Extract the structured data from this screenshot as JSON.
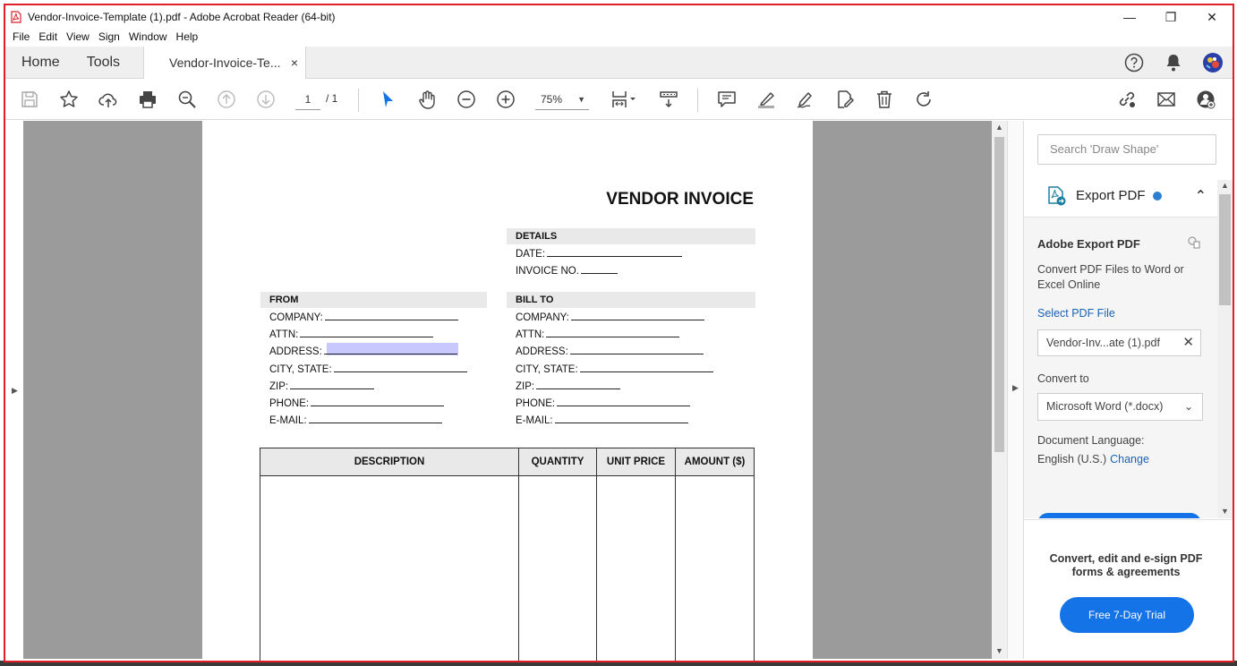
{
  "window": {
    "title": "Vendor-Invoice-Template (1).pdf - Adobe Acrobat Reader (64-bit)",
    "controls": {
      "minimize": "—",
      "restore": "❐",
      "close": "✕"
    }
  },
  "menu": [
    "File",
    "Edit",
    "View",
    "Sign",
    "Window",
    "Help"
  ],
  "tabs": {
    "home": "Home",
    "tools": "Tools",
    "document": "Vendor-Invoice-Te...",
    "close": "×"
  },
  "toolbar": {
    "page_current": "1",
    "page_total": "/ 1",
    "zoom": "75%",
    "zoom_caret": "▼"
  },
  "document": {
    "title": "VENDOR INVOICE",
    "details": {
      "heading": "DETAILS",
      "date": "DATE:",
      "invoice_no": "INVOICE NO."
    },
    "from": {
      "heading": "FROM",
      "company": "COMPANY:",
      "attn": "ATTN:",
      "address": "ADDRESS:",
      "city_state": "CITY, STATE:",
      "zip": "ZIP:",
      "phone": "PHONE:",
      "email": "E-MAIL:"
    },
    "bill_to": {
      "heading": "BILL TO",
      "company": "COMPANY:",
      "attn": "ATTN:",
      "address": "ADDRESS:",
      "city_state": "CITY, STATE:",
      "zip": "ZIP:",
      "phone": "PHONE:",
      "email": "E-MAIL:"
    },
    "table_headers": [
      "DESCRIPTION",
      "QUANTITY",
      "UNIT PRICE",
      "AMOUNT ($)"
    ]
  },
  "panel": {
    "search_placeholder": "Search 'Draw Shape'",
    "export_header": "Export PDF",
    "export_title": "Adobe Export PDF",
    "export_desc": "Convert PDF Files to Word or Excel Online",
    "select_link": "Select PDF File",
    "file_name": "Vendor-Inv...ate (1).pdf",
    "file_clear": "✕",
    "convert_label": "Convert to",
    "convert_value": "Microsoft Word (*.docx)",
    "lang_label": "Document Language:",
    "lang_value": "English (U.S.)",
    "lang_change": "Change",
    "promo_text": "Convert, edit and e-sign PDF forms & agreements",
    "trial_button": "Free 7-Day Trial"
  },
  "colors": {
    "window_border": "#e21f26",
    "accent_blue": "#1473e6",
    "link_blue": "#1a62b5",
    "doc_gray": "#9b9b9b"
  }
}
